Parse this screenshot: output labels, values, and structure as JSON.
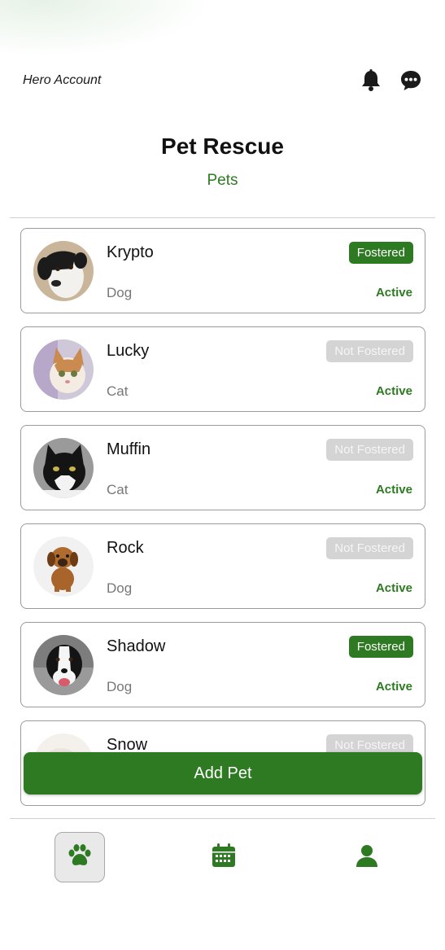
{
  "header": {
    "account_label": "Hero Account",
    "icons": [
      "bell-icon",
      "chat-icon"
    ]
  },
  "page": {
    "title": "Pet Rescue",
    "subtitle": "Pets"
  },
  "pets": [
    {
      "name": "Krypto",
      "type": "Dog",
      "foster_status": "Fostered",
      "fostered": true,
      "status": "Active"
    },
    {
      "name": "Lucky",
      "type": "Cat",
      "foster_status": "Not Fostered",
      "fostered": false,
      "status": "Active"
    },
    {
      "name": "Muffin",
      "type": "Cat",
      "foster_status": "Not Fostered",
      "fostered": false,
      "status": "Active"
    },
    {
      "name": "Rock",
      "type": "Dog",
      "foster_status": "Not Fostered",
      "fostered": false,
      "status": "Active"
    },
    {
      "name": "Shadow",
      "type": "Dog",
      "foster_status": "Fostered",
      "fostered": true,
      "status": "Active"
    },
    {
      "name": "Snow",
      "type": "",
      "foster_status": "Not Fostered",
      "fostered": false,
      "status": ""
    }
  ],
  "actions": {
    "add_pet_label": "Add Pet"
  },
  "bottom_nav": {
    "items": [
      {
        "icon": "paw-icon",
        "active": true
      },
      {
        "icon": "calendar-icon",
        "active": false
      },
      {
        "icon": "user-icon",
        "active": false
      }
    ]
  },
  "colors": {
    "accent": "#2e7a22",
    "badge_inactive": "#d4d4d4"
  }
}
